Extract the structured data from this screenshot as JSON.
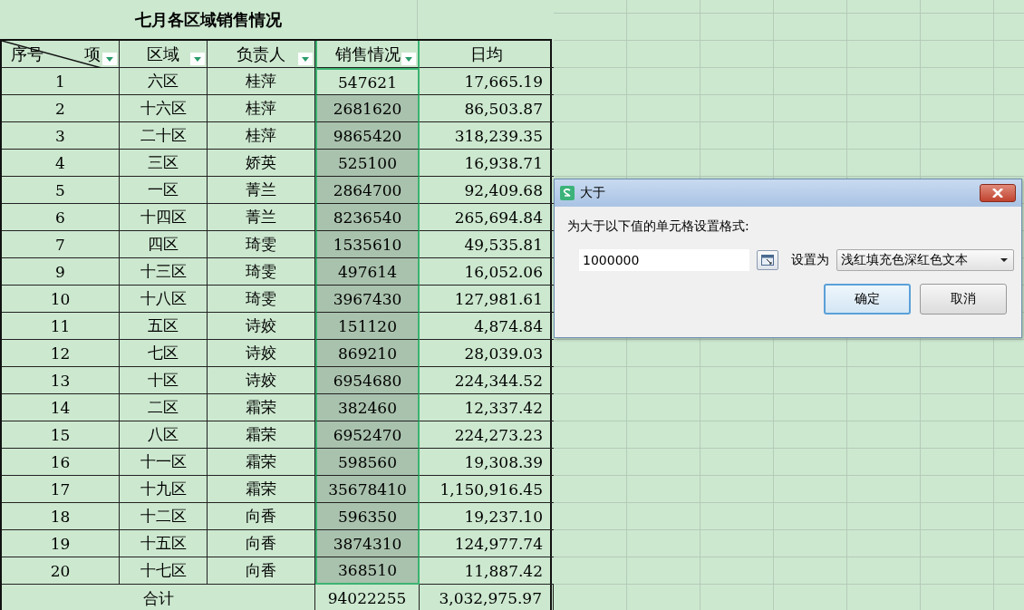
{
  "sheet": {
    "title": "七月各区域销售情况",
    "columns": [
      {
        "label": "序号",
        "label_2": "项",
        "filter": true
      },
      {
        "label": "区域",
        "filter": true
      },
      {
        "label": "负责人",
        "filter": true
      },
      {
        "label": "销售情况",
        "filter": true
      },
      {
        "label": "日均",
        "filter": false
      }
    ],
    "rows": [
      {
        "no": "1",
        "area": "六区",
        "owner": "桂萍",
        "sales": "547621",
        "daily": "17,665.19",
        "selected": true,
        "active": true
      },
      {
        "no": "2",
        "area": "十六区",
        "owner": "桂萍",
        "sales": "2681620",
        "daily": "86,503.87",
        "selected": true,
        "active": false
      },
      {
        "no": "3",
        "area": "二十区",
        "owner": "桂萍",
        "sales": "9865420",
        "daily": "318,239.35",
        "selected": true,
        "active": false
      },
      {
        "no": "4",
        "area": "三区",
        "owner": "娇英",
        "sales": "525100",
        "daily": "16,938.71",
        "selected": true,
        "active": false
      },
      {
        "no": "5",
        "area": "一区",
        "owner": "菁兰",
        "sales": "2864700",
        "daily": "92,409.68",
        "selected": true,
        "active": false
      },
      {
        "no": "6",
        "area": "十四区",
        "owner": "菁兰",
        "sales": "8236540",
        "daily": "265,694.84",
        "selected": true,
        "active": false
      },
      {
        "no": "7",
        "area": "四区",
        "owner": "琦雯",
        "sales": "1535610",
        "daily": "49,535.81",
        "selected": true,
        "active": false
      },
      {
        "no": "9",
        "area": "十三区",
        "owner": "琦雯",
        "sales": "497614",
        "daily": "16,052.06",
        "selected": true,
        "active": false
      },
      {
        "no": "10",
        "area": "十八区",
        "owner": "琦雯",
        "sales": "3967430",
        "daily": "127,981.61",
        "selected": true,
        "active": false
      },
      {
        "no": "11",
        "area": "五区",
        "owner": "诗姣",
        "sales": "151120",
        "daily": "4,874.84",
        "selected": true,
        "active": false
      },
      {
        "no": "12",
        "area": "七区",
        "owner": "诗姣",
        "sales": "869210",
        "daily": "28,039.03",
        "selected": true,
        "active": false
      },
      {
        "no": "13",
        "area": "十区",
        "owner": "诗姣",
        "sales": "6954680",
        "daily": "224,344.52",
        "selected": true,
        "active": false
      },
      {
        "no": "14",
        "area": "二区",
        "owner": "霜荣",
        "sales": "382460",
        "daily": "12,337.42",
        "selected": true,
        "active": false
      },
      {
        "no": "15",
        "area": "八区",
        "owner": "霜荣",
        "sales": "6952470",
        "daily": "224,273.23",
        "selected": true,
        "active": false
      },
      {
        "no": "16",
        "area": "十一区",
        "owner": "霜荣",
        "sales": "598560",
        "daily": "19,308.39",
        "selected": true,
        "active": false
      },
      {
        "no": "17",
        "area": "十九区",
        "owner": "霜荣",
        "sales": "35678410",
        "daily": "1,150,916.45",
        "selected": true,
        "active": false
      },
      {
        "no": "18",
        "area": "十二区",
        "owner": "向香",
        "sales": "596350",
        "daily": "19,237.10",
        "selected": true,
        "active": false
      },
      {
        "no": "19",
        "area": "十五区",
        "owner": "向香",
        "sales": "3874310",
        "daily": "124,977.74",
        "selected": true,
        "active": false
      },
      {
        "no": "20",
        "area": "十七区",
        "owner": "向香",
        "sales": "368510",
        "daily": "11,887.42",
        "selected": true,
        "active": false
      }
    ],
    "total": {
      "label": "合计",
      "sales": "94022255",
      "daily": "3,032,975.97"
    }
  },
  "dialog": {
    "title": "大于",
    "prompt": "为大于以下值的单元格设置格式:",
    "value": "1000000",
    "set_label": "设置为",
    "format": "浅红填充色深红色文本",
    "buttons": [
      {
        "label": "确定",
        "default": true
      },
      {
        "label": "取消",
        "default": false
      }
    ]
  }
}
